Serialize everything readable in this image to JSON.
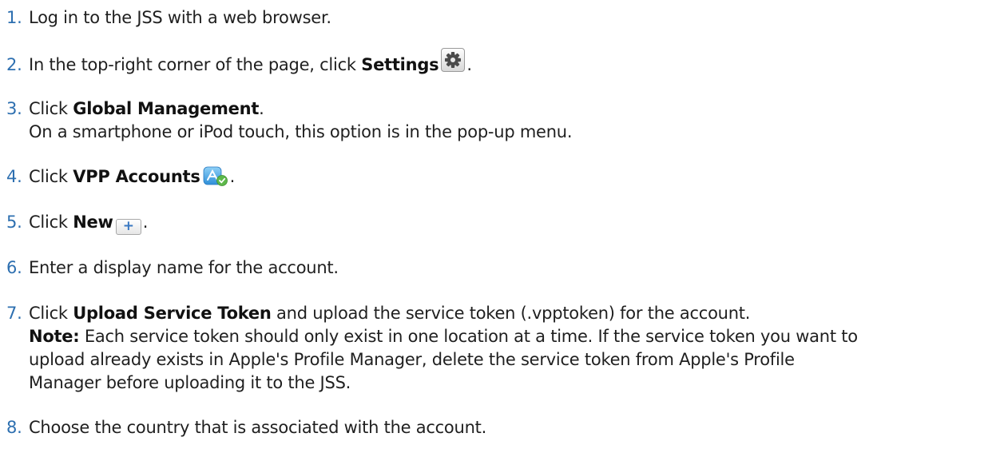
{
  "steps": [
    {
      "num": "1.",
      "text": "Log in to the JSS with a web browser."
    },
    {
      "num": "2.",
      "pre": "In the top-right corner of the page, click ",
      "bold": "Settings",
      "post": ".",
      "icon": "gear-icon"
    },
    {
      "num": "3.",
      "pre": "Click ",
      "bold": "Global Management",
      "post": ".",
      "note": "On a smartphone or iPod touch, this option is in the pop-up menu."
    },
    {
      "num": "4.",
      "pre": "Click ",
      "bold": "VPP Accounts",
      "post": ".",
      "icon": "app-store-icon"
    },
    {
      "num": "5.",
      "pre": "Click ",
      "bold": "New",
      "post": ".",
      "icon": "plus-icon",
      "icon_glyph": "+"
    },
    {
      "num": "6.",
      "text": "Enter a display name for the account."
    },
    {
      "num": "7.",
      "pre": "Click ",
      "bold": "Upload Service Token",
      "post": " and upload the service token (.vpptoken) for the account.",
      "note_label": "Note:",
      "note_line1": " Each service token should only exist in one location at a time. If the service token you want to",
      "note_line2": "upload already exists in Apple's Profile Manager, delete the service token from Apple's Profile",
      "note_line3": "Manager before uploading it to the JSS."
    },
    {
      "num": "8.",
      "text": "Choose the country that is associated with the account."
    }
  ],
  "colors": {
    "number": "#2d6fb0",
    "text": "#1f1f1f",
    "plus": "#3a78c2"
  }
}
